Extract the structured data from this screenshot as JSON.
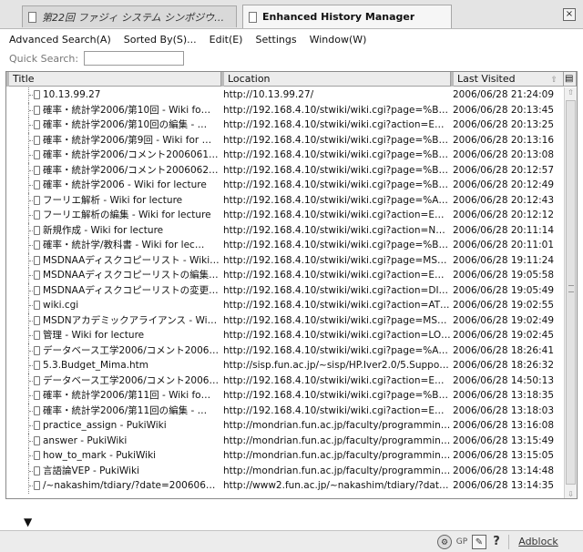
{
  "tabs": [
    {
      "label": "第22回 ファジィ システム シンポジウム …",
      "active": false
    },
    {
      "label": "Enhanced History Manager",
      "active": true
    }
  ],
  "window": {
    "close_label": "×"
  },
  "menu": {
    "advanced_search": "Advanced Search(A)",
    "sorted_by": "Sorted By(S)...",
    "edit": "Edit(E)",
    "settings": "Settings",
    "window": "Window(W)"
  },
  "quick_search": {
    "label": "Quick Search:",
    "value": "",
    "placeholder": ""
  },
  "columns": {
    "title": "Title",
    "location": "Location",
    "last_visited": "Last Visited"
  },
  "rows": [
    {
      "title": "10.13.99.27",
      "location": "http://10.13.99.27/",
      "visited": "2006/06/28 21:24:09"
    },
    {
      "title": "確率・統計学2006/第10回 - Wiki fo…",
      "location": "http://192.168.4.10/stwiki/wiki.cgi?page=%B3%CE%…",
      "visited": "2006/06/28 20:13:45"
    },
    {
      "title": "確率・統計学2006/第10回の編集 - …",
      "location": "http://192.168.4.10/stwiki/wiki.cgi?action=EDIT&p…",
      "visited": "2006/06/28 20:13:25"
    },
    {
      "title": "確率・統計学2006/第9回 - Wiki for …",
      "location": "http://192.168.4.10/stwiki/wiki.cgi?page=%B3%CE%…",
      "visited": "2006/06/28 20:13:16"
    },
    {
      "title": "確率・統計学2006/コメント20060613 …",
      "location": "http://192.168.4.10/stwiki/wiki.cgi?page=%B3%CE%…",
      "visited": "2006/06/28 20:13:08"
    },
    {
      "title": "確率・統計学2006/コメント20060620 …",
      "location": "http://192.168.4.10/stwiki/wiki.cgi?page=%B3%CE%…",
      "visited": "2006/06/28 20:12:57"
    },
    {
      "title": "確率・統計学2006 - Wiki for lecture",
      "location": "http://192.168.4.10/stwiki/wiki.cgi?page=%B3%CE%…",
      "visited": "2006/06/28 20:12:49"
    },
    {
      "title": "フーリエ解析 - Wiki for lecture",
      "location": "http://192.168.4.10/stwiki/wiki.cgi?page=%A5%D5%…",
      "visited": "2006/06/28 20:12:43"
    },
    {
      "title": "フーリエ解析の編集 - Wiki for lecture",
      "location": "http://192.168.4.10/stwiki/wiki.cgi?action=EDIT&p…",
      "visited": "2006/06/28 20:12:12"
    },
    {
      "title": "新規作成 - Wiki for lecture",
      "location": "http://192.168.4.10/stwiki/wiki.cgi?action=NEW",
      "visited": "2006/06/28 20:11:14"
    },
    {
      "title": "確率・統計学/教科書 - Wiki for lec…",
      "location": "http://192.168.4.10/stwiki/wiki.cgi?page=%B3%CE%…",
      "visited": "2006/06/28 20:11:01"
    },
    {
      "title": "MSDNAAディスクコピーリスト - Wiki fo…",
      "location": "http://192.168.4.10/stwiki/wiki.cgi?page=MSDNAA…",
      "visited": "2006/06/28 19:11:24"
    },
    {
      "title": "MSDNAAディスクコピーリストの編集 - …",
      "location": "http://192.168.4.10/stwiki/wiki.cgi?action=EDIT&p…",
      "visited": "2006/06/28 19:05:58"
    },
    {
      "title": "MSDNAAディスクコピーリストの変更履…",
      "location": "http://192.168.4.10/stwiki/wiki.cgi?action=DIFF&p…",
      "visited": "2006/06/28 19:05:49"
    },
    {
      "title": "wiki.cgi",
      "location": "http://192.168.4.10/stwiki/wiki.cgi?action=ATTAC…",
      "visited": "2006/06/28 19:02:55"
    },
    {
      "title": "MSDNアカデミックアライアンス - Wiki f…",
      "location": "http://192.168.4.10/stwiki/wiki.cgi?page=MSDN%A…",
      "visited": "2006/06/28 19:02:49"
    },
    {
      "title": "管理 - Wiki for lecture",
      "location": "http://192.168.4.10/stwiki/wiki.cgi?action=LOGIN",
      "visited": "2006/06/28 19:02:45"
    },
    {
      "title": "データベース工学2006/コメント200606…",
      "location": "http://192.168.4.10/stwiki/wiki.cgi?page=%A5%C7%…",
      "visited": "2006/06/28 18:26:41"
    },
    {
      "title": "5.3.Budget_Mima.htm",
      "location": "http://sisp.fun.ac.jp/~sisp/HP.Iver2.0/5.Support/5…",
      "visited": "2006/06/28 18:26:32"
    },
    {
      "title": "データベース工学2006/コメント200606…",
      "location": "http://192.168.4.10/stwiki/wiki.cgi?action=EDIT&p…",
      "visited": "2006/06/28 14:50:13"
    },
    {
      "title": "確率・統計学2006/第11回 - Wiki fo…",
      "location": "http://192.168.4.10/stwiki/wiki.cgi?page=%B3%CE%…",
      "visited": "2006/06/28 13:18:35"
    },
    {
      "title": "確率・統計学2006/第11回の編集 - …",
      "location": "http://192.168.4.10/stwiki/wiki.cgi?action=EDIT&p…",
      "visited": "2006/06/28 13:18:03"
    },
    {
      "title": "practice_assign - PukiWiki",
      "location": "http://mondrian.fun.ac.jp/faculty/programming/ind…",
      "visited": "2006/06/28 13:16:08"
    },
    {
      "title": "answer - PukiWiki",
      "location": "http://mondrian.fun.ac.jp/faculty/programming/ind…",
      "visited": "2006/06/28 13:15:49"
    },
    {
      "title": "how_to_mark - PukiWiki",
      "location": "http://mondrian.fun.ac.jp/faculty/programming/ind…",
      "visited": "2006/06/28 13:15:05"
    },
    {
      "title": "言語論VEP - PukiWiki",
      "location": "http://mondrian.fun.ac.jp/faculty/programming/ind…",
      "visited": "2006/06/28 13:14:48"
    },
    {
      "title": "/~nakashim/tdiary/?date=20060628…",
      "location": "http://www2.fun.ac.jp/~nakashim/tdiary/?date=20…",
      "visited": "2006/06/28 13:14:35"
    }
  ],
  "status": {
    "gp_label": "GP",
    "help_label": "?",
    "adblock_label": "Adblock",
    "arrow": "▼"
  },
  "icons": {
    "tab_page": "page-icon",
    "row_page": "page-icon",
    "close": "close-icon",
    "gear": "gear-icon",
    "pencil": "pencil-icon",
    "help": "help-icon",
    "sort": "sort-icon",
    "column_picker": "column-picker-icon"
  }
}
